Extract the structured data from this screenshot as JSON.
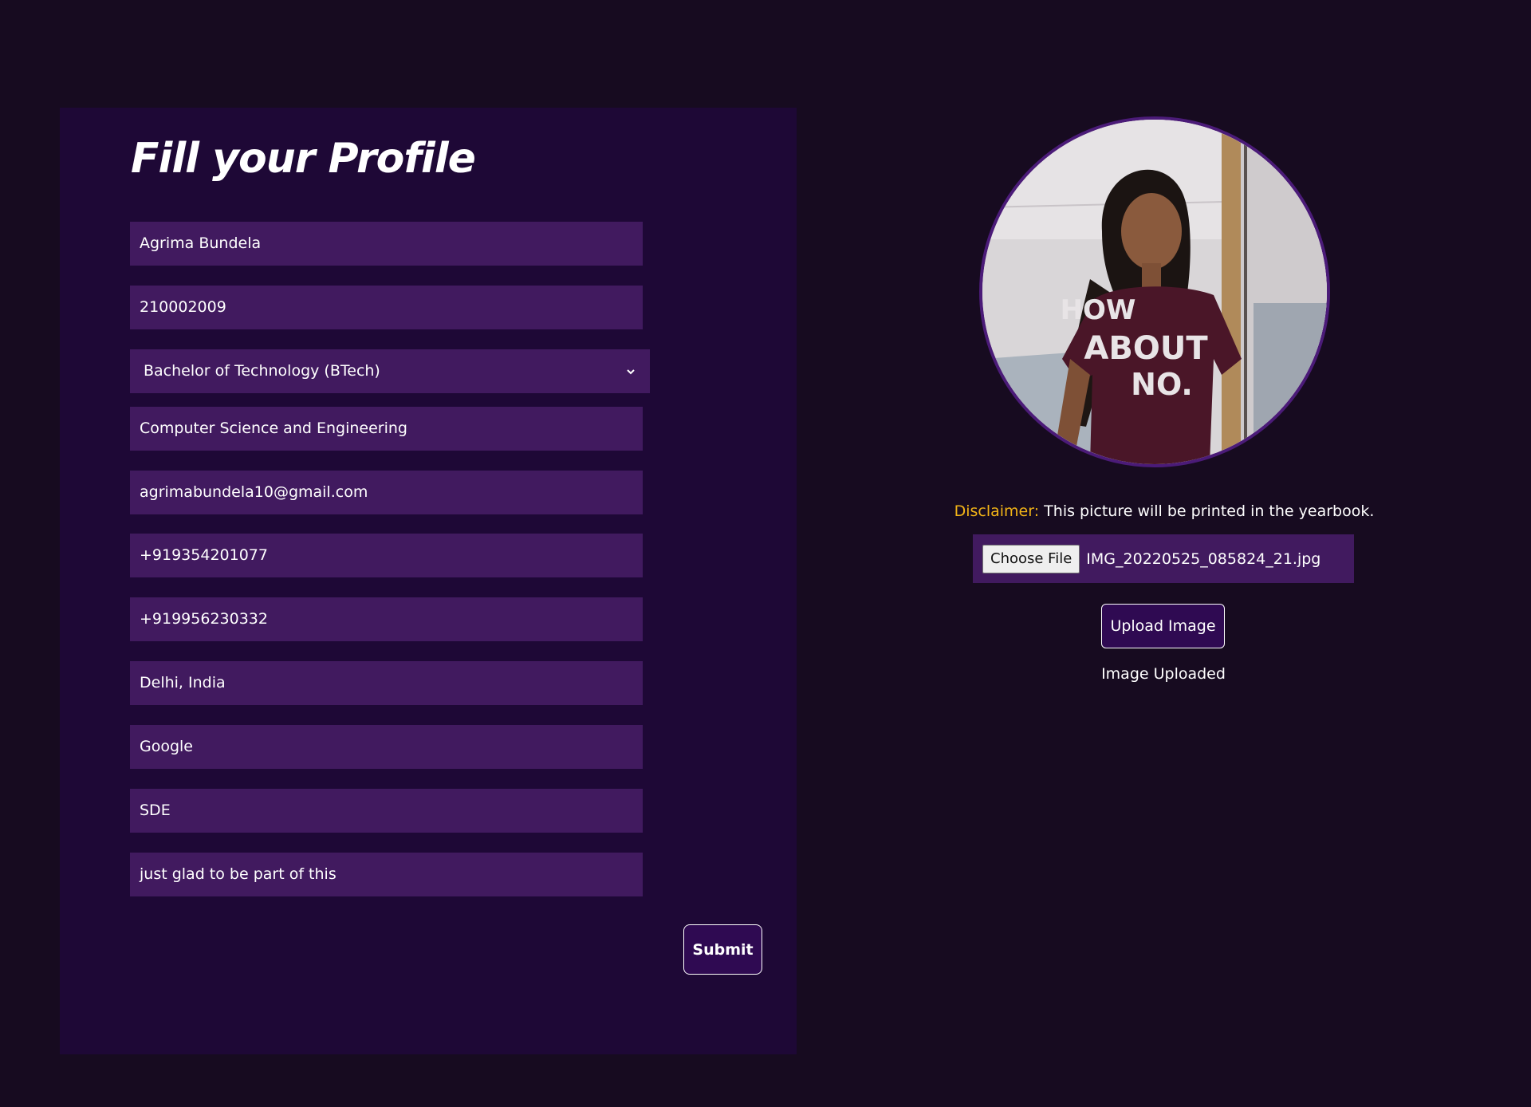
{
  "form": {
    "title": "Fill your Profile",
    "fields": {
      "name": "Agrima Bundela",
      "roll_number": "210002009",
      "degree": "Bachelor of Technology (BTech)",
      "department": "Computer Science and Engineering",
      "email": "agrimabundela10@gmail.com",
      "phone": "+919354201077",
      "alt_phone": "+919956230332",
      "location": "Delhi, India",
      "company": "Google",
      "role": "SDE",
      "comment": "just glad to be part of this"
    },
    "submit_label": "Submit"
  },
  "photo": {
    "tshirt_print": [
      "HOW",
      "ABOUT",
      "NO."
    ]
  },
  "upload": {
    "disclaimer_label": "Disclaimer:",
    "disclaimer_text": "This picture will be printed in the yearbook.",
    "choose_file_label": "Choose File",
    "file_name": "IMG_20220525_085824_21.jpg",
    "upload_label": "Upload Image",
    "status": "Image Uploaded"
  },
  "colors": {
    "background": "#170b20",
    "panel": "#1e0836",
    "field": "#411a5f",
    "button": "#2f0a52",
    "disclaimer_accent": "#f2b417"
  }
}
